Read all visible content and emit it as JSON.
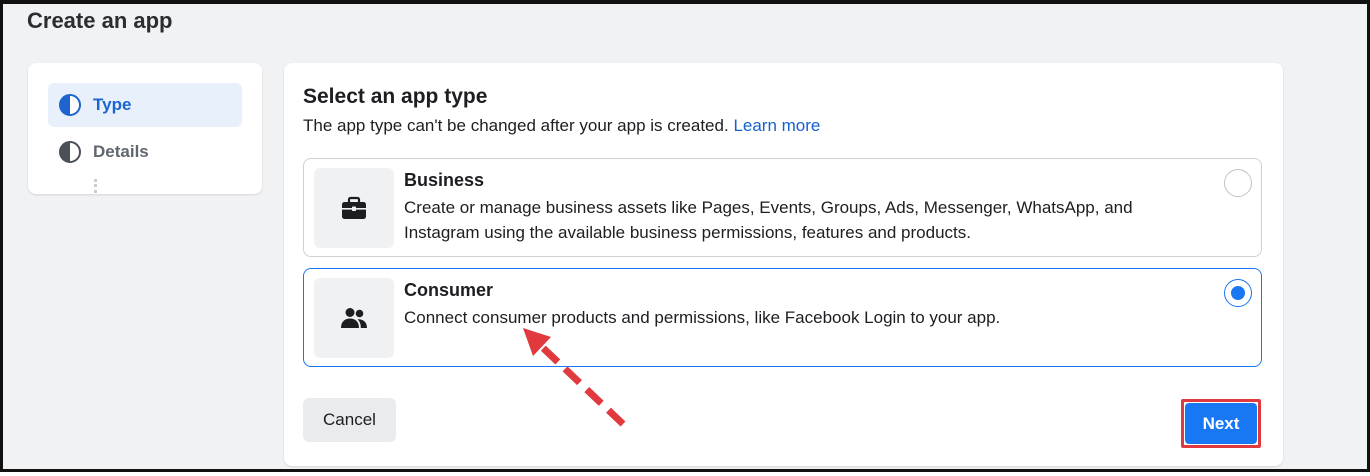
{
  "page": {
    "title": "Create an app"
  },
  "steps": [
    {
      "label": "Type",
      "state": "active"
    },
    {
      "label": "Details",
      "state": "inactive"
    }
  ],
  "main": {
    "title": "Select an app type",
    "subtitle": "The app type can't be changed after your app is created.",
    "learn_more": "Learn more",
    "options": [
      {
        "title": "Business",
        "description": "Create or manage business assets like Pages, Events, Groups, Ads, Messenger, WhatsApp, and Instagram using the available business permissions, features and products.",
        "icon": "briefcase-icon",
        "selected": false
      },
      {
        "title": "Consumer",
        "description": "Connect consumer products and permissions, like Facebook Login to your app.",
        "icon": "people-icon",
        "selected": true
      }
    ]
  },
  "actions": {
    "cancel_label": "Cancel",
    "next_label": "Next"
  },
  "colors": {
    "accent": "#1877f2",
    "active_step_text": "#1d64cf",
    "highlight_red": "#e0393e",
    "background": "#f1f2f4"
  }
}
